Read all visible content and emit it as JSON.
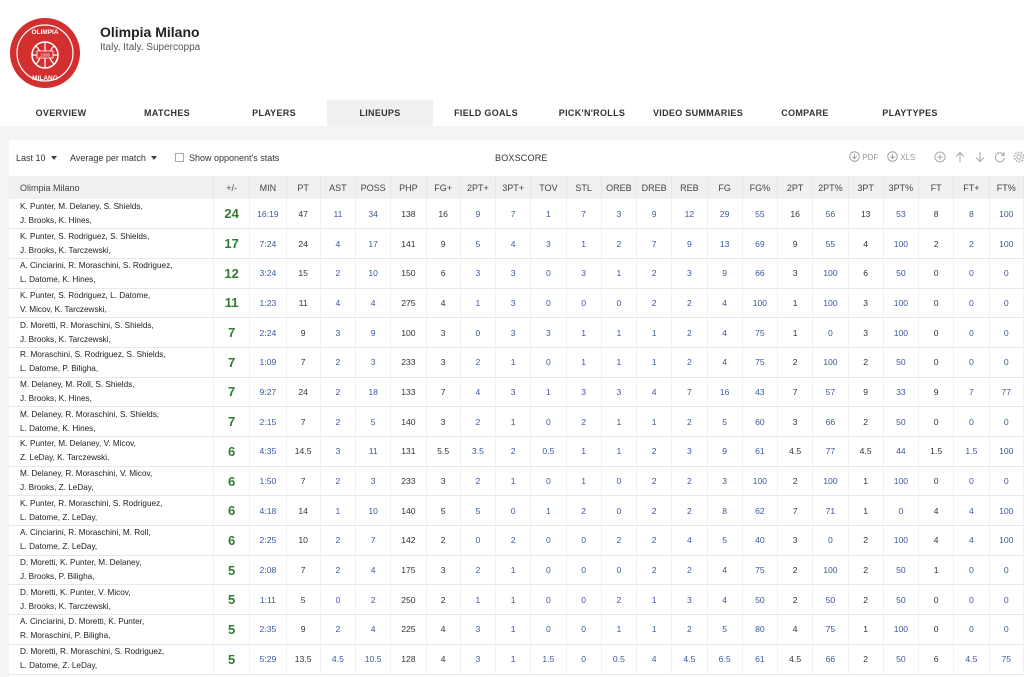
{
  "team": {
    "name": "Olimpia Milano",
    "subtitle": "Italy, Italy. Supercoppa",
    "logo_text_top": "OLIMPIA",
    "logo_text_bottom": "MILANO",
    "logo_year": "1936"
  },
  "tabs": [
    {
      "label": "OVERVIEW"
    },
    {
      "label": "MATCHES"
    },
    {
      "label": "PLAYERS"
    },
    {
      "label": "LINEUPS"
    },
    {
      "label": "FIELD GOALS"
    },
    {
      "label": "PICK'N'ROLLS"
    },
    {
      "label": "VIDEO SUMMARIES"
    },
    {
      "label": "COMPARE"
    },
    {
      "label": "PLAYTYPES"
    }
  ],
  "active_tab": "LINEUPS",
  "controls": {
    "range": "Last 10",
    "mode": "Average per match",
    "opponent_label": "Show opponent's stats",
    "boxscore": "BOXSCORE",
    "pdf": "PDF",
    "xls": "XLS"
  },
  "colors": {
    "accent": "#d32f2f",
    "plus_minus": "#2e7d32",
    "link": "#3a5a9c",
    "header_bg": "#eef0f2"
  },
  "columns": [
    "Olimpia Milano",
    "+/-",
    "MIN",
    "PT",
    "AST",
    "POSS",
    "PHP",
    "FG+",
    "2PT+",
    "3PT+",
    "TOV",
    "STL",
    "OREB",
    "DREB",
    "REB",
    "FG",
    "FG%",
    "2PT",
    "2PT%",
    "3PT",
    "3PT%",
    "FT",
    "FT+",
    "FT%"
  ],
  "rows": [
    {
      "l1": "K. Punter,   M. Delaney,   S. Shields,",
      "l2": "J. Brooks,   K. Hines,",
      "v": [
        "24",
        "16:19",
        "47",
        "11",
        "34",
        "138",
        "16",
        "9",
        "7",
        "1",
        "7",
        "3",
        "9",
        "12",
        "29",
        "55",
        "16",
        "56",
        "13",
        "53",
        "8",
        "8",
        "100"
      ]
    },
    {
      "l1": "K. Punter,   S. Rodriguez,   S. Shields,",
      "l2": "J. Brooks,   K. Tarczewski,",
      "v": [
        "17",
        "7:24",
        "24",
        "4",
        "17",
        "141",
        "9",
        "5",
        "4",
        "3",
        "1",
        "2",
        "7",
        "9",
        "13",
        "69",
        "9",
        "55",
        "4",
        "100",
        "2",
        "2",
        "100"
      ]
    },
    {
      "l1": "A. Cinciarini,   R. Moraschini,   S. Rodriguez,",
      "l2": "L. Datome,   K. Hines,",
      "v": [
        "12",
        "3:24",
        "15",
        "2",
        "10",
        "150",
        "6",
        "3",
        "3",
        "0",
        "3",
        "1",
        "2",
        "3",
        "9",
        "66",
        "3",
        "100",
        "6",
        "50",
        "0",
        "0",
        "0"
      ]
    },
    {
      "l1": "K. Punter,   S. Rodriguez,   L. Datome,",
      "l2": "V. Micov,   K. Tarczewski,",
      "v": [
        "11",
        "1:23",
        "11",
        "4",
        "4",
        "275",
        "4",
        "1",
        "3",
        "0",
        "0",
        "0",
        "2",
        "2",
        "4",
        "100",
        "1",
        "100",
        "3",
        "100",
        "0",
        "0",
        "0"
      ]
    },
    {
      "l1": "D. Moretti,   R. Moraschini,   S. Shields,",
      "l2": "J. Brooks,   K. Tarczewski,",
      "v": [
        "7",
        "2:24",
        "9",
        "3",
        "9",
        "100",
        "3",
        "0",
        "3",
        "3",
        "1",
        "1",
        "1",
        "2",
        "4",
        "75",
        "1",
        "0",
        "3",
        "100",
        "0",
        "0",
        "0"
      ]
    },
    {
      "l1": "R. Moraschini,   S. Rodriguez,   S. Shields,",
      "l2": "L. Datome,   P. Biligha,",
      "v": [
        "7",
        "1:09",
        "7",
        "2",
        "3",
        "233",
        "3",
        "2",
        "1",
        "0",
        "1",
        "1",
        "1",
        "2",
        "4",
        "75",
        "2",
        "100",
        "2",
        "50",
        "0",
        "0",
        "0"
      ]
    },
    {
      "l1": "M. Delaney,   M. Roll,   S. Shields,",
      "l2": "J. Brooks,   K. Hines,",
      "v": [
        "7",
        "9:27",
        "24",
        "2",
        "18",
        "133",
        "7",
        "4",
        "3",
        "1",
        "3",
        "3",
        "4",
        "7",
        "16",
        "43",
        "7",
        "57",
        "9",
        "33",
        "9",
        "7",
        "77"
      ]
    },
    {
      "l1": "M. Delaney,   R. Moraschini,   S. Shields,",
      "l2": "L. Datome,   K. Hines,",
      "v": [
        "7",
        "2:15",
        "7",
        "2",
        "5",
        "140",
        "3",
        "2",
        "1",
        "0",
        "2",
        "1",
        "1",
        "2",
        "5",
        "60",
        "3",
        "66",
        "2",
        "50",
        "0",
        "0",
        "0"
      ]
    },
    {
      "l1": "K. Punter,   M. Delaney,   V. Micov,",
      "l2": "Z. LeDay,   K. Tarczewski,",
      "v": [
        "6",
        "4:35",
        "14.5",
        "3",
        "11",
        "131",
        "5.5",
        "3.5",
        "2",
        "0.5",
        "1",
        "1",
        "2",
        "3",
        "9",
        "61",
        "4.5",
        "77",
        "4.5",
        "44",
        "1.5",
        "1.5",
        "100"
      ]
    },
    {
      "l1": "M. Delaney,   R. Moraschini,   V. Micov,",
      "l2": "J. Brooks,   Z. LeDay,",
      "v": [
        "6",
        "1:50",
        "7",
        "2",
        "3",
        "233",
        "3",
        "2",
        "1",
        "0",
        "1",
        "0",
        "2",
        "2",
        "3",
        "100",
        "2",
        "100",
        "1",
        "100",
        "0",
        "0",
        "0"
      ]
    },
    {
      "l1": "K. Punter,   R. Moraschini,   S. Rodriguez,",
      "l2": "L. Datome,   Z. LeDay,",
      "v": [
        "6",
        "4:18",
        "14",
        "1",
        "10",
        "140",
        "5",
        "5",
        "0",
        "1",
        "2",
        "0",
        "2",
        "2",
        "8",
        "62",
        "7",
        "71",
        "1",
        "0",
        "4",
        "4",
        "100"
      ]
    },
    {
      "l1": "A. Cinciarini,   R. Moraschini,   M. Roll,",
      "l2": "L. Datome,   Z. LeDay,",
      "v": [
        "6",
        "2:25",
        "10",
        "2",
        "7",
        "142",
        "2",
        "0",
        "2",
        "0",
        "0",
        "2",
        "2",
        "4",
        "5",
        "40",
        "3",
        "0",
        "2",
        "100",
        "4",
        "4",
        "100"
      ]
    },
    {
      "l1": "D. Moretti,   K. Punter,   M. Delaney,",
      "l2": "J. Brooks,   P. Biligha,",
      "v": [
        "5",
        "2:08",
        "7",
        "2",
        "4",
        "175",
        "3",
        "2",
        "1",
        "0",
        "0",
        "0",
        "2",
        "2",
        "4",
        "75",
        "2",
        "100",
        "2",
        "50",
        "1",
        "0",
        "0"
      ]
    },
    {
      "l1": "D. Moretti,   K. Punter,   V. Micov,",
      "l2": "J. Brooks,   K. Tarczewski,",
      "v": [
        "5",
        "1:11",
        "5",
        "0",
        "2",
        "250",
        "2",
        "1",
        "1",
        "0",
        "0",
        "2",
        "1",
        "3",
        "4",
        "50",
        "2",
        "50",
        "2",
        "50",
        "0",
        "0",
        "0"
      ]
    },
    {
      "l1": "A. Cinciarini,   D. Moretti,   K. Punter,",
      "l2": "R. Moraschini,   P. Biligha,",
      "v": [
        "5",
        "2:35",
        "9",
        "2",
        "4",
        "225",
        "4",
        "3",
        "1",
        "0",
        "0",
        "1",
        "1",
        "2",
        "5",
        "80",
        "4",
        "75",
        "1",
        "100",
        "0",
        "0",
        "0"
      ]
    },
    {
      "l1": "D. Moretti,   R. Moraschini,   S. Rodriguez,",
      "l2": "L. Datome,   Z. LeDay,",
      "v": [
        "5",
        "5:29",
        "13.5",
        "4.5",
        "10.5",
        "128",
        "4",
        "3",
        "1",
        "1.5",
        "0",
        "0.5",
        "4",
        "4.5",
        "6.5",
        "61",
        "4.5",
        "66",
        "2",
        "50",
        "6",
        "4.5",
        "75"
      ]
    }
  ]
}
